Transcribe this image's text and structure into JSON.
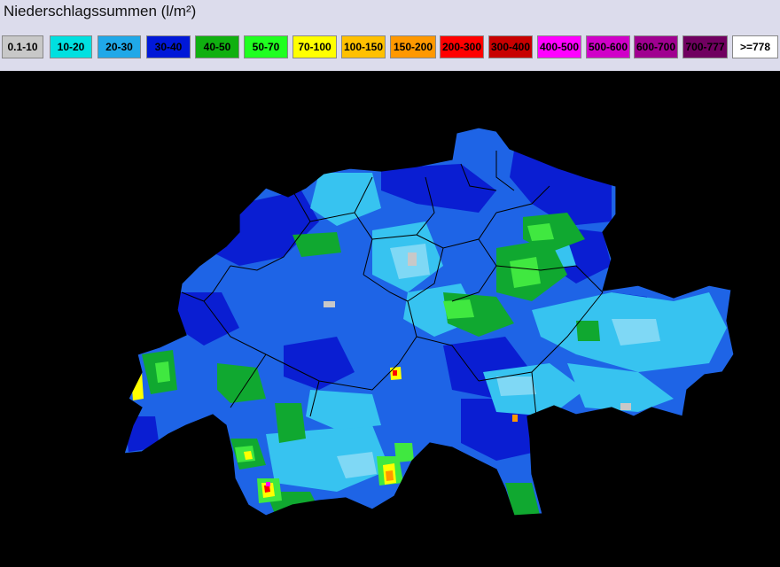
{
  "title": "Niederschlagssummen (l/m²)",
  "legend": [
    {
      "label": "0.1-10",
      "bg": "#c8c8c8",
      "fg": "#000000"
    },
    {
      "label": "10-20",
      "bg": "#00e0e0",
      "fg": "#000000"
    },
    {
      "label": "20-30",
      "bg": "#20a8e8",
      "fg": "#000000"
    },
    {
      "label": "30-40",
      "bg": "#0018d8",
      "fg": "#000000"
    },
    {
      "label": "40-50",
      "bg": "#10b010",
      "fg": "#000000"
    },
    {
      "label": "50-70",
      "bg": "#20ff20",
      "fg": "#000000"
    },
    {
      "label": "70-100",
      "bg": "#ffff00",
      "fg": "#000000"
    },
    {
      "label": "100-150",
      "bg": "#ffc000",
      "fg": "#000000"
    },
    {
      "label": "150-200",
      "bg": "#ff9800",
      "fg": "#000000"
    },
    {
      "label": "200-300",
      "bg": "#ff0000",
      "fg": "#000000"
    },
    {
      "label": "300-400",
      "bg": "#c80000",
      "fg": "#000000"
    },
    {
      "label": "400-500",
      "bg": "#ff00ff",
      "fg": "#000000"
    },
    {
      "label": "500-600",
      "bg": "#d000c8",
      "fg": "#000000"
    },
    {
      "label": "600-700",
      "bg": "#a00090",
      "fg": "#000000"
    },
    {
      "label": "700-777",
      "bg": "#700060",
      "fg": "#000000"
    },
    {
      "label": ">=778",
      "bg": "#ffffff",
      "fg": "#000000"
    }
  ]
}
